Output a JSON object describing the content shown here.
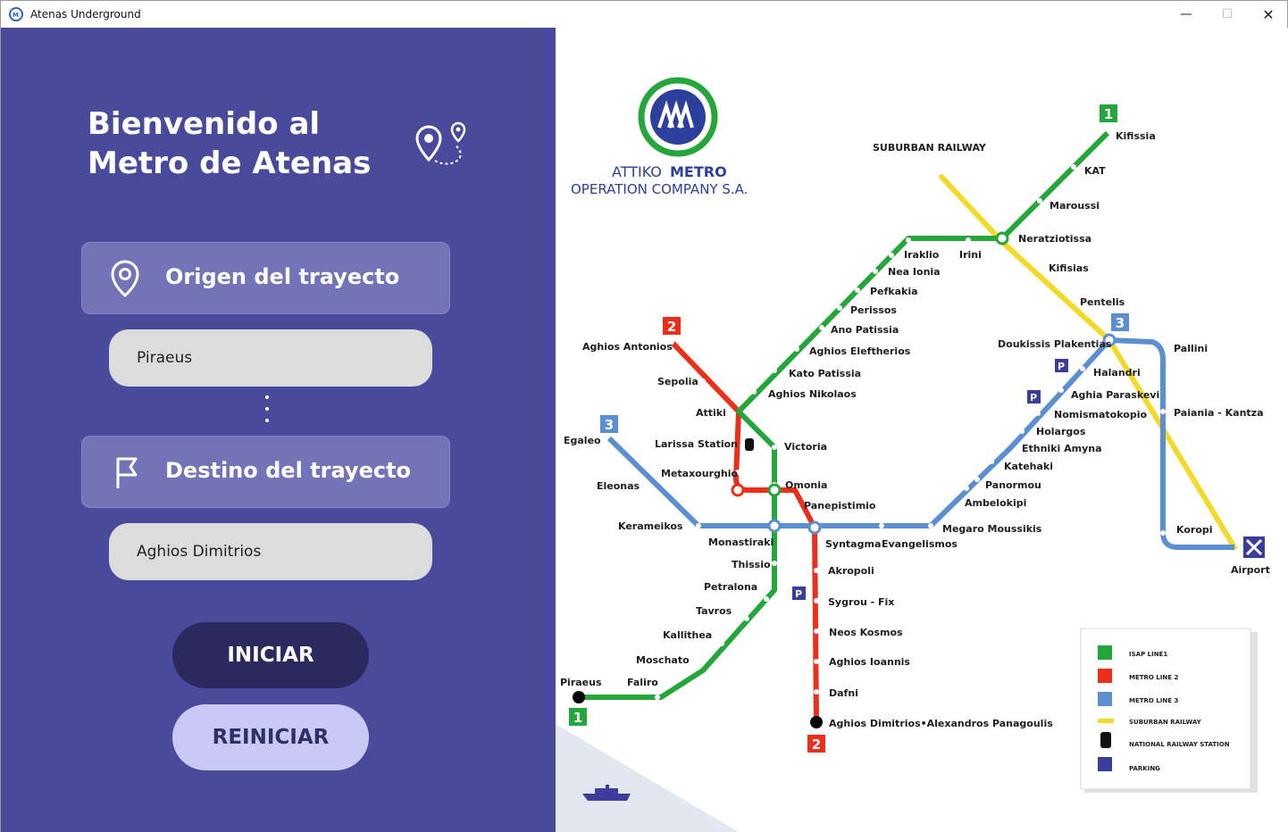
{
  "window": {
    "title": "Atenas Underground",
    "controls": {
      "minimize": "—",
      "maximize": "☐",
      "close": "✕"
    }
  },
  "sidebar": {
    "welcome": "Bienvenido al Metro de Atenas",
    "origin_label": "Origen del trayecto",
    "origin_value": "Piraeus",
    "destination_label": "Destino del trayecto",
    "destination_value": "Aghios Dimitrios",
    "start_button": "INICIAR",
    "reset_button": "REINICIAR",
    "colors": {
      "panel": "#4a4a9c",
      "card": "#7373b8",
      "start": "#2a2a5e",
      "reset": "#c9c9f6"
    }
  },
  "map": {
    "company_top": "ATTIKO",
    "company_bold": "METRO",
    "company_bottom": "OPERATION COMPANY S.A.",
    "suburban_title": "SUBURBAN RAILWAY",
    "line_colors": {
      "line1": "#23a73a",
      "line2": "#ec2f1b",
      "line3": "#5b8fd1",
      "suburban": "#f5d928"
    },
    "line_badges": {
      "line1": "1",
      "line2": "2",
      "line3": "3"
    },
    "stations": {
      "kifissia": "Kifissia",
      "kat": "KAT",
      "maroussi": "Maroussi",
      "neratziotissa": "Neratziotissa",
      "kifisias": "Kifisias",
      "irini": "Irini",
      "iraklio": "Iraklio",
      "nea_ionia": "Nea Ionia",
      "pefkakia": "Pefkakia",
      "perissos": "Perissos",
      "ano_patissia": "Ano Patissia",
      "aghios_eleftherios": "Aghios Eleftherios",
      "kato_patissia": "Kato Patissia",
      "aghios_nikolaos": "Aghios Nikolaos",
      "pentelis": "Pentelis",
      "doukissis": "Doukissis Plakentias",
      "pallini": "Pallini",
      "halandri": "Halandri",
      "aghia_paraskevi": "Aghia Paraskevi",
      "nomismatokopio": "Nomismatokopio",
      "holargos": "Holargos",
      "ethniki_amyna": "Ethniki Amyna",
      "katehaki": "Katehaki",
      "panormou": "Panormou",
      "ambelokipi": "Ambelokipi",
      "megaro": "Megaro Moussikis",
      "paiania": "Paiania - Kantza",
      "koropi": "Koropi",
      "airport": "Airport",
      "aghios_antonios": "Aghios Antonios",
      "sepolia": "Sepolia",
      "attiki": "Attiki",
      "larissa": "Larissa Station",
      "victoria": "Victoria",
      "metaxourghio": "Metaxourghio",
      "omonia": "Omonia",
      "egaleo": "Egaleo",
      "eleonas": "Eleonas",
      "panepistimio": "Panepistimio",
      "kerameikos": "Kerameikos",
      "monastiraki": "Monastiraki",
      "syntagma": "Syntagma",
      "evangelismos": "Evangelismos",
      "thissio": "Thissio",
      "akropoli": "Akropoli",
      "petralona": "Petralona",
      "sygrou": "Sygrou - Fix",
      "tavros": "Tavros",
      "kallithea": "Kallithea",
      "neos_kosmos": "Neos Kosmos",
      "moschato": "Moschato",
      "aghios_ioannis": "Aghios Ioannis",
      "piraeus": "Piraeus",
      "faliro": "Faliro",
      "dafni": "Dafni",
      "aghios_dimitrios": "Aghios Dimitrios•Alexandros Panagoulis"
    },
    "legend": {
      "isap": "ISAP LINE1",
      "metro2": "METRO LINE 2",
      "metro3": "METRO LINE 3",
      "suburban": "SUBURBAN RAILWAY",
      "railway": "NATIONAL RAILWAY STATION",
      "parking": "PARKING",
      "parking_badge": "P"
    }
  }
}
